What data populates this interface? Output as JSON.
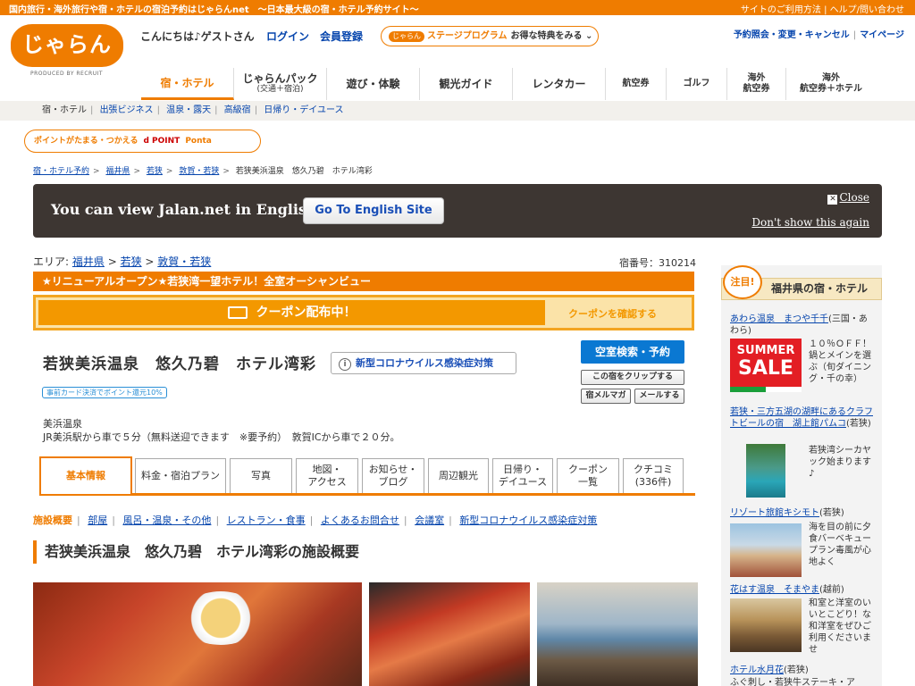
{
  "topbar": {
    "left": "国内旅行・海外旅行や宿・ホテルの宿泊予約はじゃらんnet　〜日本最大級の宿・ホテル予約サイト〜",
    "guide": "サイトのご利用方法",
    "help": "ヘルプ/問い合わせ"
  },
  "header": {
    "logo": "じゃらん",
    "logo_sub": "PRODUCED BY RECRUIT",
    "greeting": "こんにちは♪ゲストさん",
    "login": "ログイン",
    "register": "会員登録",
    "stage_badge": "じゃらん",
    "stage_program": "ステージプログラム",
    "stage_perk": "お得な特典をみる ⌄",
    "reservation_link": "予約照会・変更・キャンセル",
    "mypage_link": "マイページ"
  },
  "gnav": [
    {
      "label": "宿・ホテル",
      "sub": ""
    },
    {
      "label": "じゃらんパック",
      "sub": "(交通＋宿泊)"
    },
    {
      "label": "遊び・体験",
      "sub": ""
    },
    {
      "label": "観光ガイド",
      "sub": ""
    },
    {
      "label": "レンタカー",
      "sub": ""
    },
    {
      "label": "航空券",
      "sub": ""
    },
    {
      "label": "ゴルフ",
      "sub": ""
    },
    {
      "label": "海外",
      "sub": "航空券"
    },
    {
      "label": "海外",
      "sub": "航空券＋ホテル"
    }
  ],
  "subnav": [
    "宿・ホテル",
    "出張ビジネス",
    "温泉・露天",
    "高級宿",
    "日帰り・デイユース"
  ],
  "pointbar": {
    "text": "ポイントがたまる・つかえる",
    "dpoint": "d POINT",
    "ponta": "Ponta"
  },
  "breadcrumb": [
    "宿・ホテル予約",
    "福井県",
    "若狭",
    "敦賀・若狭",
    "若狭美浜温泉　悠久乃碧　ホテル湾彩"
  ],
  "english_banner": {
    "message": "You can view Jalan.net in English.",
    "button": "Go To English Site",
    "close": "Close",
    "dont_show": "Don't show this again"
  },
  "area": {
    "label": "エリア:",
    "links": [
      "福井県",
      "若狭",
      "敦賀・若狭"
    ]
  },
  "hotel_no": "宿番号：310214",
  "promo": "★リニューアルオープン★若狭湾一望ホテル！全室オーシャンビュー",
  "coupon": {
    "main": "クーポン配布中！",
    "confirm": "クーポンを確認する"
  },
  "hotel": {
    "name": "若狭美浜温泉　悠久乃碧　ホテル湾彩",
    "covid": "新型コロナウイルス感染症対策",
    "point_tag": "事前カード決済でポイント還元10%",
    "onsen": "美浜温泉",
    "access": "JR美浜駅から車で５分（無料送迎できます　※要予約）　敦賀ICから車で２０分。"
  },
  "actions": {
    "search": "空室検索・予約",
    "clip": "この宿をクリップする",
    "magazine": "宿メルマガ",
    "mail": "メールする"
  },
  "tabs": [
    {
      "line1": "基本情報",
      "line2": ""
    },
    {
      "line1": "料金・宿泊プラン",
      "line2": ""
    },
    {
      "line1": "写真",
      "line2": ""
    },
    {
      "line1": "地図・",
      "line2": "アクセス"
    },
    {
      "line1": "お知らせ・",
      "line2": "ブログ"
    },
    {
      "line1": "周辺観光",
      "line2": ""
    },
    {
      "line1": "日帰り・",
      "line2": "デイユース"
    },
    {
      "line1": "クーポン",
      "line2": "一覧"
    },
    {
      "line1": "クチコミ",
      "line2": "(336件)"
    }
  ],
  "anchors": [
    "施設概要",
    "部屋",
    "風呂・温泉・その他",
    "レストラン・食事",
    "よくあるお問合せ",
    "会議室",
    "新型コロナウイルス感染症対策"
  ],
  "section_title": "若狭美浜温泉　悠久乃碧　ホテル湾彩の施設概要",
  "sidebar": {
    "badge": "注目!",
    "title": "福井県の宿・ホテル",
    "items": [
      {
        "name": "あわら温泉　まつや千千",
        "area": "(三国・あわら)",
        "desc": "１０％ＯＦＦ！鍋とメインを選ぶ（旬ダイニング・千の幸）",
        "sale1": "SUMMER",
        "sale2": "SALE"
      },
      {
        "name": "若狭・三方五湖の湖畔にあるクラフトビールの宿　湖上館パムコ",
        "area": "(若狭)",
        "desc": "若狭湾シーカヤック始まります♪"
      },
      {
        "name": "リゾート旅館キシモト",
        "area": "(若狭)",
        "desc": "海を目の前に夕食バーベキュープラン毒風が心地よく"
      },
      {
        "name": "花はす温泉　そまやま",
        "area": "(越前)",
        "desc": "和室と洋室のいいとこどり！な和洋室をぜひご利用くださいませ"
      },
      {
        "name": "ホテル水月花",
        "area": "(若狭)",
        "desc": "ふぐ刺し・若狭牛ステーキ・ア"
      }
    ]
  }
}
